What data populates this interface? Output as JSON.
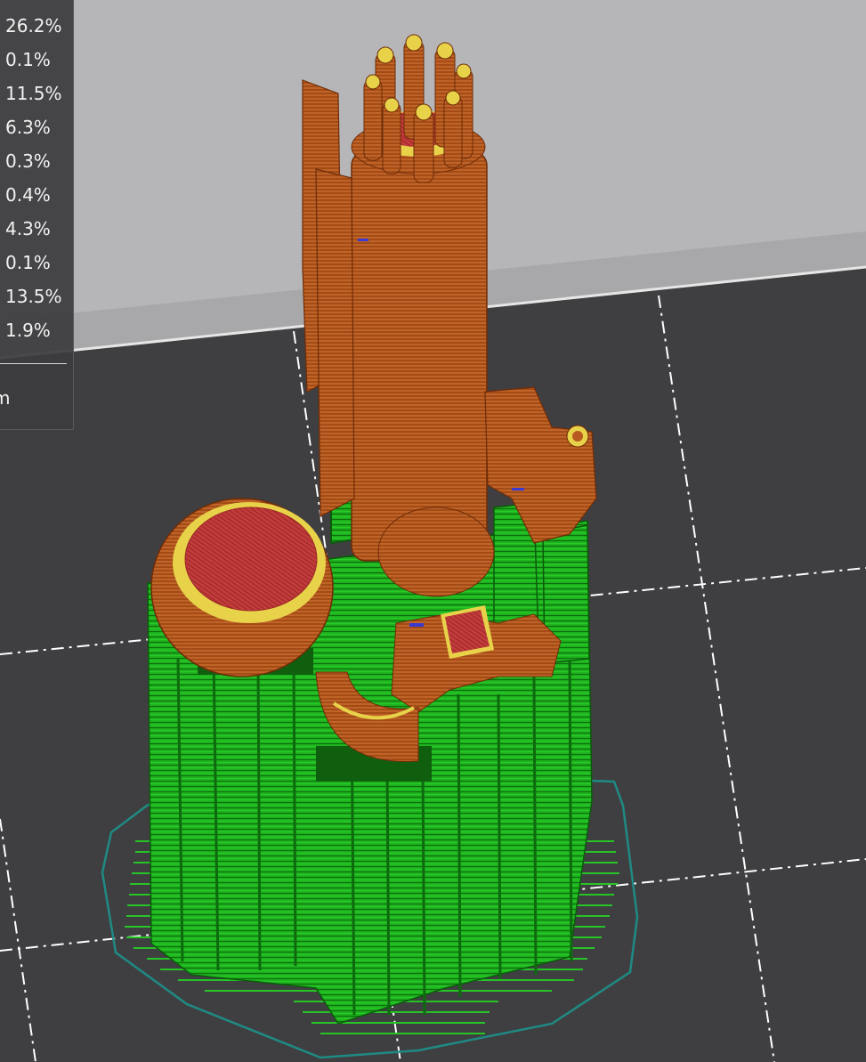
{
  "legend": {
    "percentages": [
      "26.2%",
      "0.1%",
      "11.5%",
      "6.3%",
      "0.3%",
      "0.4%",
      "4.3%",
      "0.1%",
      "13.5%",
      "1.9%"
    ],
    "footer_text": "m"
  },
  "colors": {
    "bed": "#3f3f41",
    "back_wall": "#b4b4b6",
    "bed_grid_lines": "#ffffff",
    "perimeter": "#b8561e",
    "support": "#1fba1f",
    "top_solid_infill": "#c23a3a",
    "outer_ring": "#e8d24a",
    "skirt": "#1f8a84",
    "wipe": "#3a3ad0"
  }
}
